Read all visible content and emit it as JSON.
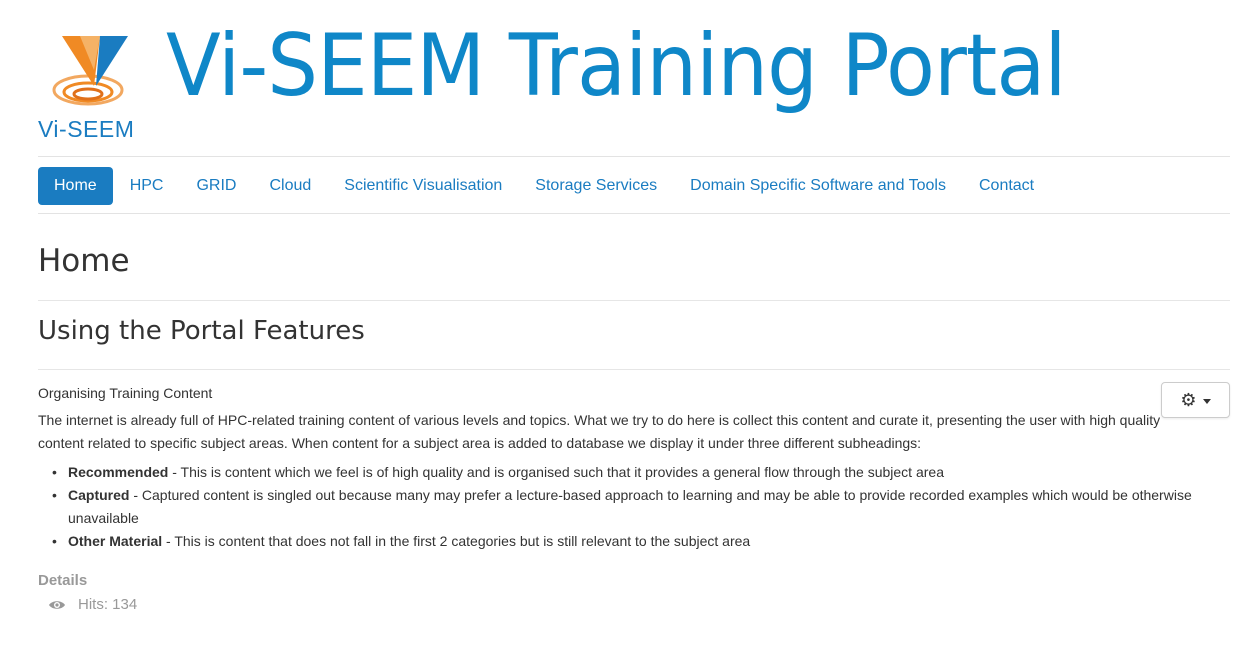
{
  "header": {
    "logo_text": "Vi-SEEM",
    "site_title": "Vi-SEEM Training Portal",
    "colors": {
      "brand_blue": "#0f87c8",
      "logo_orange": "#f08a24"
    }
  },
  "nav": {
    "items": [
      {
        "label": "Home",
        "active": true
      },
      {
        "label": "HPC"
      },
      {
        "label": "GRID"
      },
      {
        "label": "Cloud"
      },
      {
        "label": "Scientific Visualisation"
      },
      {
        "label": "Storage Services"
      },
      {
        "label": "Domain Specific Software and Tools"
      },
      {
        "label": "Contact"
      }
    ]
  },
  "page": {
    "heading": "Home",
    "article_title": "Using the Portal Features",
    "tools_icon": "gear-icon",
    "subhead": "Organising Training Content",
    "intro": "The internet is already full of HPC-related training content of various levels and topics. What we try to do here is collect this content and curate it, presenting the user with high quality content related to specific subject areas. When content for a subject area is added to database we display it under three different subheadings:",
    "bullets": [
      {
        "term": "Recommended",
        "text": " - This is content which we feel is of high quality and is organised such that it provides a general flow through the subject area"
      },
      {
        "term": "Captured",
        "text": " - Captured content is singled out because many may prefer a lecture-based approach to learning and may be able to provide recorded examples which would be otherwise unavailable"
      },
      {
        "term": "Other Material",
        "text": " - This is content that does not fall in the first 2 categories but is still relevant to the subject area"
      }
    ],
    "details_label": "Details",
    "hits_text": "Hits: 134"
  }
}
